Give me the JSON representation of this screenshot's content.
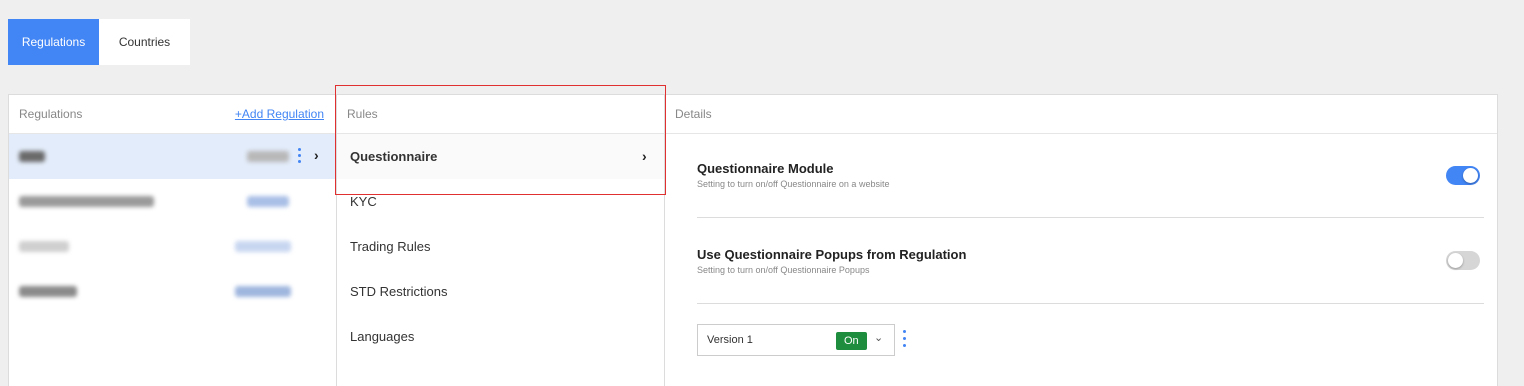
{
  "tabs": [
    {
      "label": "Regulations",
      "active": true
    },
    {
      "label": "Countries",
      "active": false
    }
  ],
  "regulations_panel": {
    "title": "Regulations",
    "add_link": "+Add Regulation"
  },
  "rules_panel": {
    "title": "Rules",
    "items": [
      "Questionnaire",
      "KYC",
      "Trading Rules",
      "STD Restrictions",
      "Languages"
    ],
    "selected": "Questionnaire"
  },
  "details_panel": {
    "title": "Details",
    "settings": [
      {
        "title": "Questionnaire Module",
        "description": "Setting to turn on/off Questionnaire on a website",
        "enabled": true
      },
      {
        "title": "Use Questionnaire Popups from Regulation",
        "description": "Setting to turn on/off Questionnaire Popups",
        "enabled": false
      }
    ],
    "version": {
      "label": "Version 1",
      "status": "On"
    }
  },
  "colors": {
    "accent": "#4285f4",
    "highlight_border": "#e03030",
    "on_badge": "#1e8e3e"
  },
  "icons": [
    "chevron-right-icon",
    "kebab-menu-icon",
    "chevron-down-icon"
  ]
}
